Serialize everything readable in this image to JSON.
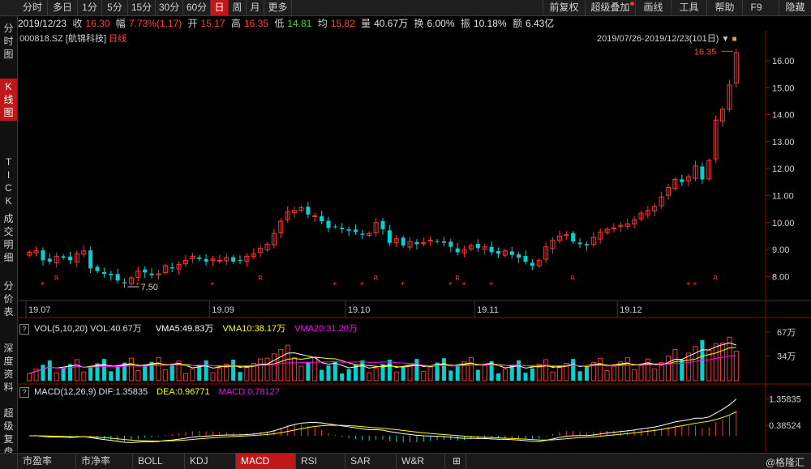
{
  "toolbar": {
    "periods": [
      "分时",
      "多日",
      "1分",
      "5分",
      "15分",
      "30分",
      "60分",
      "日",
      "周",
      "月",
      "更多"
    ],
    "active_period": "日",
    "right_items": [
      "前复权",
      "超级叠加",
      "画线",
      "工具",
      "帮助",
      "F9",
      "隐藏"
    ]
  },
  "quote": {
    "date": "2019/12/23",
    "close_label": "收",
    "close": "16.30",
    "change_label": "幅",
    "change": "7.73%(1.17)",
    "open_label": "开",
    "open": "15.17",
    "high_label": "高",
    "high": "16.35",
    "low_label": "低",
    "low": "14.81",
    "avg_label": "均",
    "avg": "15.82",
    "volume_label": "量",
    "volume": "40.67万",
    "turnover_label": "换",
    "turnover": "6.00%",
    "amplitude_label": "振",
    "amplitude": "10.18%",
    "amount_label": "额",
    "amount": "6.43亿"
  },
  "sidebar": [
    "分时图",
    "K线图",
    "TICK",
    "成交明细",
    "分价表",
    "深度资料",
    "超级复盘"
  ],
  "sidebar_active": "K线图",
  "stock": {
    "code": "000818.SZ",
    "name": "[航锦科技]",
    "period": "日线"
  },
  "range": "2019/07/26-2019/12/23(101日)",
  "price_axis": [
    "16.00",
    "15.00",
    "14.00",
    "13.00",
    "12.00",
    "11.00",
    "10.00",
    "9.00",
    "8.00"
  ],
  "annotations": {
    "high": "16.35",
    "low": "7.50"
  },
  "date_axis": [
    "19.07",
    "19.09",
    "19.10",
    "19.11",
    "19.12"
  ],
  "volume_panel": {
    "label": "VOL(5,10,20)",
    "vol": "VOL:40.67万",
    "vma5": "VMA5:49.83万",
    "vma10": "VMA10:38.17万",
    "vma20": "VMA20:31.20万",
    "axis": [
      "67万",
      "34万"
    ]
  },
  "macd_panel": {
    "label": "MACD(12,26,9)",
    "dif": "DIF:1.35835",
    "dea": "DEA:0.96771",
    "macd": "MACD:0.78127",
    "axis": [
      "1.35835",
      "0.38524"
    ]
  },
  "bottom_tabs": [
    "市盈率",
    "市净率",
    "BOLL",
    "KDJ",
    "MACD",
    "RSI",
    "SAR",
    "W&R"
  ],
  "bottom_active": "MACD",
  "watermark": "@格隆汇",
  "colors": {
    "up": "#ff3232",
    "down": "#00d2d2",
    "vma5": "#ffffff",
    "vma10": "#ffff00",
    "vma20": "#ff00ff",
    "accent": "#c01818"
  },
  "chart_data": {
    "type": "candlestick",
    "closes": [
      8.9,
      8.95,
      8.6,
      8.55,
      8.75,
      8.7,
      8.6,
      8.85,
      8.95,
      8.3,
      8.2,
      8.1,
      8.05,
      7.85,
      7.75,
      7.95,
      8.2,
      8.15,
      8.05,
      8.1,
      8.4,
      8.3,
      8.45,
      8.6,
      8.75,
      8.65,
      8.55,
      8.65,
      8.6,
      8.7,
      8.55,
      8.6,
      8.75,
      8.85,
      9.05,
      9.2,
      9.6,
      10.05,
      10.4,
      10.45,
      10.55,
      10.3,
      10.25,
      10.05,
      9.8,
      9.85,
      9.75,
      9.7,
      9.65,
      9.55,
      9.6,
      10.0,
      9.75,
      9.25,
      9.4,
      9.15,
      9.3,
      9.2,
      9.25,
      9.35,
      9.3,
      9.25,
      9.1,
      8.9,
      9.0,
      9.15,
      9.05,
      9.1,
      8.9,
      8.85,
      8.95,
      8.8,
      8.7,
      8.55,
      8.4,
      8.6,
      9.1,
      9.35,
      9.5,
      9.55,
      9.3,
      9.2,
      9.15,
      9.45,
      9.65,
      9.75,
      9.8,
      9.9,
      9.95,
      10.1,
      10.35,
      10.45,
      10.6,
      10.95,
      11.3,
      11.6,
      11.5,
      11.7,
      12.1,
      11.6,
      12.3,
      13.8,
      14.2,
      15.1,
      16.3
    ],
    "ylim": [
      7.2,
      16.6
    ],
    "volume": {
      "ylim": [
        0,
        67
      ]
    },
    "macd": {
      "ylim": [
        -0.3,
        1.5
      ]
    }
  }
}
